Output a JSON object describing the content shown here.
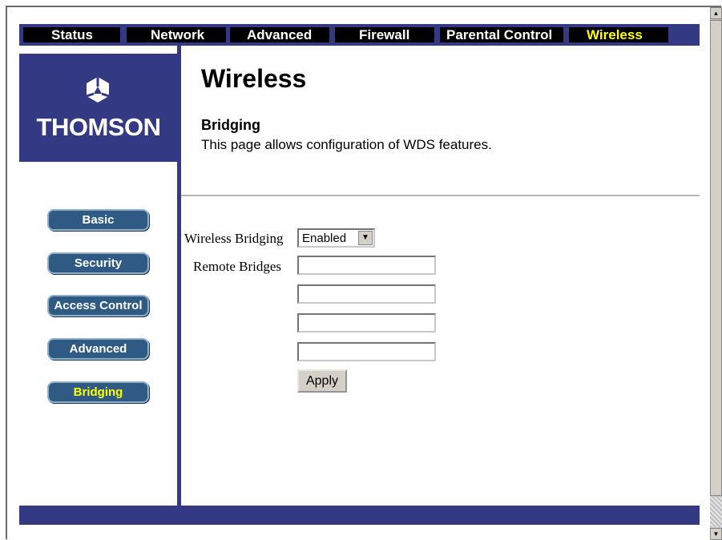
{
  "nav": {
    "tabs": [
      {
        "label": "Status"
      },
      {
        "label": "Network"
      },
      {
        "label": "Advanced"
      },
      {
        "label": "Firewall"
      },
      {
        "label": "Parental Control"
      },
      {
        "label": "Wireless"
      }
    ],
    "active_tab": "Wireless"
  },
  "brand": {
    "logo_text": "THOMSON"
  },
  "sidebar": {
    "items": [
      {
        "label": "Basic"
      },
      {
        "label": "Security"
      },
      {
        "label": "Access Control"
      },
      {
        "label": "Advanced"
      },
      {
        "label": "Bridging"
      }
    ],
    "active_item": "Bridging"
  },
  "main": {
    "page_title": "Wireless",
    "section_title": "Bridging",
    "section_description": "This page allows configuration of WDS features."
  },
  "form": {
    "wireless_bridging_label": "Wireless Bridging",
    "wireless_bridging_value": "Enabled",
    "remote_bridges_label": "Remote Bridges",
    "remote_bridges": [
      "",
      "",
      "",
      ""
    ],
    "apply_label": "Apply"
  },
  "colors": {
    "nav_bar": "#333a83",
    "active_text": "#ffff00",
    "button_blue": "#2f5a83"
  }
}
